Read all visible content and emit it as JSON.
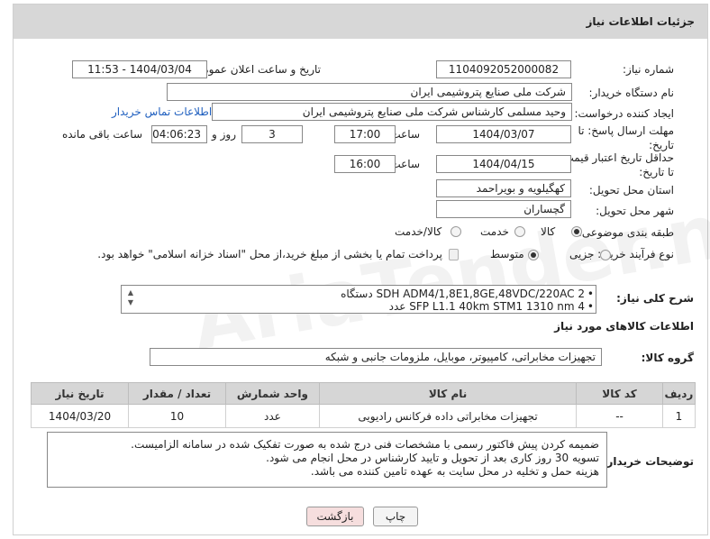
{
  "header": {
    "title": "جزئیات اطلاعات نیاز"
  },
  "fields": {
    "need_number_label": "شماره نیاز:",
    "need_number": "1104092052000082",
    "announce_label": "تاریخ و ساعت اعلان عمومی:",
    "announce_value": "1404/03/04 - 11:53",
    "buyer_org_label": "نام دستگاه خریدار:",
    "buyer_org": "شرکت ملی صنایع پتروشیمی ایران",
    "creator_label": "ایجاد کننده درخواست:",
    "creator": "وحید مسلمی کارشناس شرکت ملی صنایع پتروشیمی ایران",
    "contact_link": "اطلاعات تماس خریدار",
    "deadline_label": "مهلت ارسال پاسخ: تا تاریخ:",
    "deadline_date": "1404/03/07",
    "time_label": "ساعت",
    "deadline_time": "17:00",
    "days_value": "3",
    "days_label": "روز و",
    "remaining_time": "04:06:23",
    "remaining_label": "ساعت باقی مانده",
    "validity_label": "حداقل تاریخ اعتبار قیمت: تا تاریخ:",
    "validity_date": "1404/04/15",
    "validity_time": "16:00",
    "province_label": "استان محل تحویل:",
    "province": "کهگیلویه و بویراحمد",
    "city_label": "شهر محل تحویل:",
    "city": "گچساران",
    "category_label": "طبقه بندی موضوعی:",
    "category_options": [
      "کالا",
      "خدمت",
      "کالا/خدمت"
    ],
    "process_label": "نوع فرآیند خرید :",
    "process_options": [
      "جزیی",
      "متوسط"
    ],
    "payment_note": "پرداخت تمام یا بخشی از مبلغ خرید،از محل \"اسناد خزانه اسلامی\" خواهد بود."
  },
  "description": {
    "label": "شرح کلی نیاز:",
    "items": [
      "SDH ADM4/1,8E1,8GE,48VDC/220AC 2 دستگاه",
      "SFP L1.1 40km STM1 1310 nm 4 عدد"
    ]
  },
  "goods_section": {
    "title": "اطلاعات کالاهای مورد نیاز",
    "group_label": "گروه کالا:",
    "group_value": "تجهیزات مخابراتی، کامپیوتر، موبایل، ملزومات جانبی و شبکه",
    "columns": [
      "ردیف",
      "کد کالا",
      "نام کالا",
      "واحد شمارش",
      "تعداد / مقدار",
      "تاریخ نیاز"
    ],
    "rows": [
      [
        "1",
        "--",
        "تجهیزات مخابراتی داده فرکانس رادیویی",
        "عدد",
        "10",
        "1404/03/20"
      ]
    ]
  },
  "notes": {
    "label": "توضیحات خریدار:",
    "lines": [
      "ضمیمه کردن پیش فاکتور رسمی با مشخصات فنی درج شده  به صورت تفکیک شده در سامانه الزامیست.",
      "تسویه 30 روز کاری بعد از تحویل و تایید  کارشناس در محل انجام می شود.",
      "هزینه حمل و تخلیه در محل سایت به عهده تامین کننده می باشد."
    ]
  },
  "buttons": {
    "print": "چاپ",
    "back": "بازگشت"
  },
  "colors": {
    "header_bg": "#d7d7d7",
    "link": "#1f5fbf",
    "back_btn": "#f6dede"
  }
}
